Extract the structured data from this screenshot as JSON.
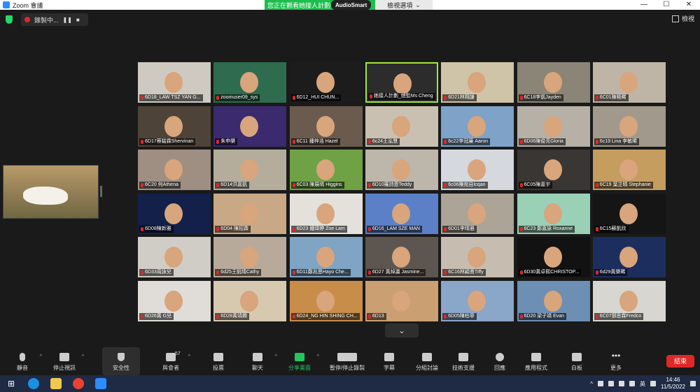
{
  "window": {
    "title": "Zoom 會議",
    "share_banner": "您正在觀看她接人計劃",
    "share_pill": "AudioSmart",
    "share_options": "檢視選項",
    "controls": [
      "—",
      "☐",
      "✕"
    ]
  },
  "top": {
    "recording_label": "錄製中...",
    "view_label": "檢視"
  },
  "participants": [
    {
      "name": "6D18_LAW TSZ YAN G...",
      "bg": "#cfcac1"
    },
    {
      "name": "zoomuser09_sys",
      "bg": "#2f6b4f"
    },
    {
      "name": "6D12_HUI CHUN...",
      "bg": "#1c1c1c"
    },
    {
      "name": "她接人計劃_總監Ms Cheng",
      "bg": "#2c2c2c"
    },
    {
      "name": "6D21林翱謙",
      "bg": "#cfc3a8"
    },
    {
      "name": "6C18李凱Jayden",
      "bg": "#8a8577"
    },
    {
      "name": "6C01陳曉晞",
      "bg": "#bfb5a6"
    },
    {
      "name": "6D17蔡駿霖Shervinan",
      "bg": "#4d4338"
    },
    {
      "name": "朱申樂",
      "bg": "#3b2a6e"
    },
    {
      "name": "6C11 鍾梓浩 Hazel",
      "bg": "#6b5b4f"
    },
    {
      "name": "6c24王泓慧",
      "bg": "#c9c0b2"
    },
    {
      "name": "6c22李冠廉 Aaron",
      "bg": "#7fa2c9"
    },
    {
      "name": "6D06陳俊亮Gloria",
      "bg": "#b7b0a7"
    },
    {
      "name": "6c19 Lina 李敏晞",
      "bg": "#a19a8c"
    },
    {
      "name": "6C20 何Athena",
      "bg": "#9f8f83"
    },
    {
      "name": "6D14洪嘉凱",
      "bg": "#b5ad9c"
    },
    {
      "name": "6C03 陳展晴 Higgins",
      "bg": "#6fa245"
    },
    {
      "name": "6D10羅詩恩Teddy",
      "bg": "#bdb6aa"
    },
    {
      "name": "6c06陳宛自Icqan",
      "bg": "#d5d8dc"
    },
    {
      "name": "6C05陳嘉宇",
      "bg": "#3a3633"
    },
    {
      "name": "6C19 葉芷晴 Stephanie",
      "bg": "#c59d5f"
    },
    {
      "name": "6D08陳新雅",
      "bg": "#12204a"
    },
    {
      "name": "6D04 陳招霖",
      "bg": "#c9a886"
    },
    {
      "name": "6D23 鍾瑋婷 Zoe Lam",
      "bg": "#e4e1dc"
    },
    {
      "name": "6D16_LAM SZE MAN",
      "bg": "#5b80c7"
    },
    {
      "name": "6D01李晴雅",
      "bg": "#aba497"
    },
    {
      "name": "6C23 鄭嘉詠 Roxanne",
      "bg": "#9ad0b6"
    },
    {
      "name": "6C15蘇凱欣",
      "bg": "#151515"
    },
    {
      "name": "6D33周詠兒",
      "bg": "#cfcdc6"
    },
    {
      "name": "6d25王凱晴Cathy",
      "bg": "#b8aa9a"
    },
    {
      "name": "6D11鄭兆恩Hayo Che...",
      "bg": "#7fa4c4"
    },
    {
      "name": "6D27 黃焯瀛 Jasmine...",
      "bg": "#5d5650"
    },
    {
      "name": "6C16林穎熹Tiffy",
      "bg": "#c6bdb0"
    },
    {
      "name": "6D30黃卓熙CHRISTOP...",
      "bg": "#121212"
    },
    {
      "name": "6d29黃樂晞",
      "bg": "#1c2e5e"
    },
    {
      "name": "6D26黃 G兒",
      "bg": "#e0ddd8"
    },
    {
      "name": "6D28黃靖嫻",
      "bg": "#d6c9b0"
    },
    {
      "name": "6D24_NG HIN SHING CH...",
      "bg": "#c98d4a"
    },
    {
      "name": "6D13",
      "bg": "#caa072"
    },
    {
      "name": "6D05陳柏寧",
      "bg": "#8aa6c8"
    },
    {
      "name": "6D20 梁子靖 Evan",
      "bg": "#6d8fb3"
    },
    {
      "name": "6C07鄧思霖Fredco",
      "bg": "#d8d6d0"
    }
  ],
  "toolbar": {
    "mute": "靜音",
    "stop_video": "停止視訊",
    "security": "安全性",
    "participants": "與會者",
    "participants_count": "57",
    "polls": "投票",
    "chat": "聊天",
    "share": "分享畫面",
    "record": "暫停/停止錄製",
    "captions": "字幕",
    "breakout": "分組討論",
    "remote_support": "技術支援",
    "reactions": "回應",
    "apps": "應用程式",
    "whiteboard": "白板",
    "more": "更多",
    "end": "結束"
  },
  "taskbar": {
    "tray_lang": "英",
    "time": "14:46",
    "date": "11/5/2022"
  },
  "colors": {
    "accent_green": "#23c55e",
    "end_red": "#e02828",
    "active_speaker": "#a3e63c"
  }
}
